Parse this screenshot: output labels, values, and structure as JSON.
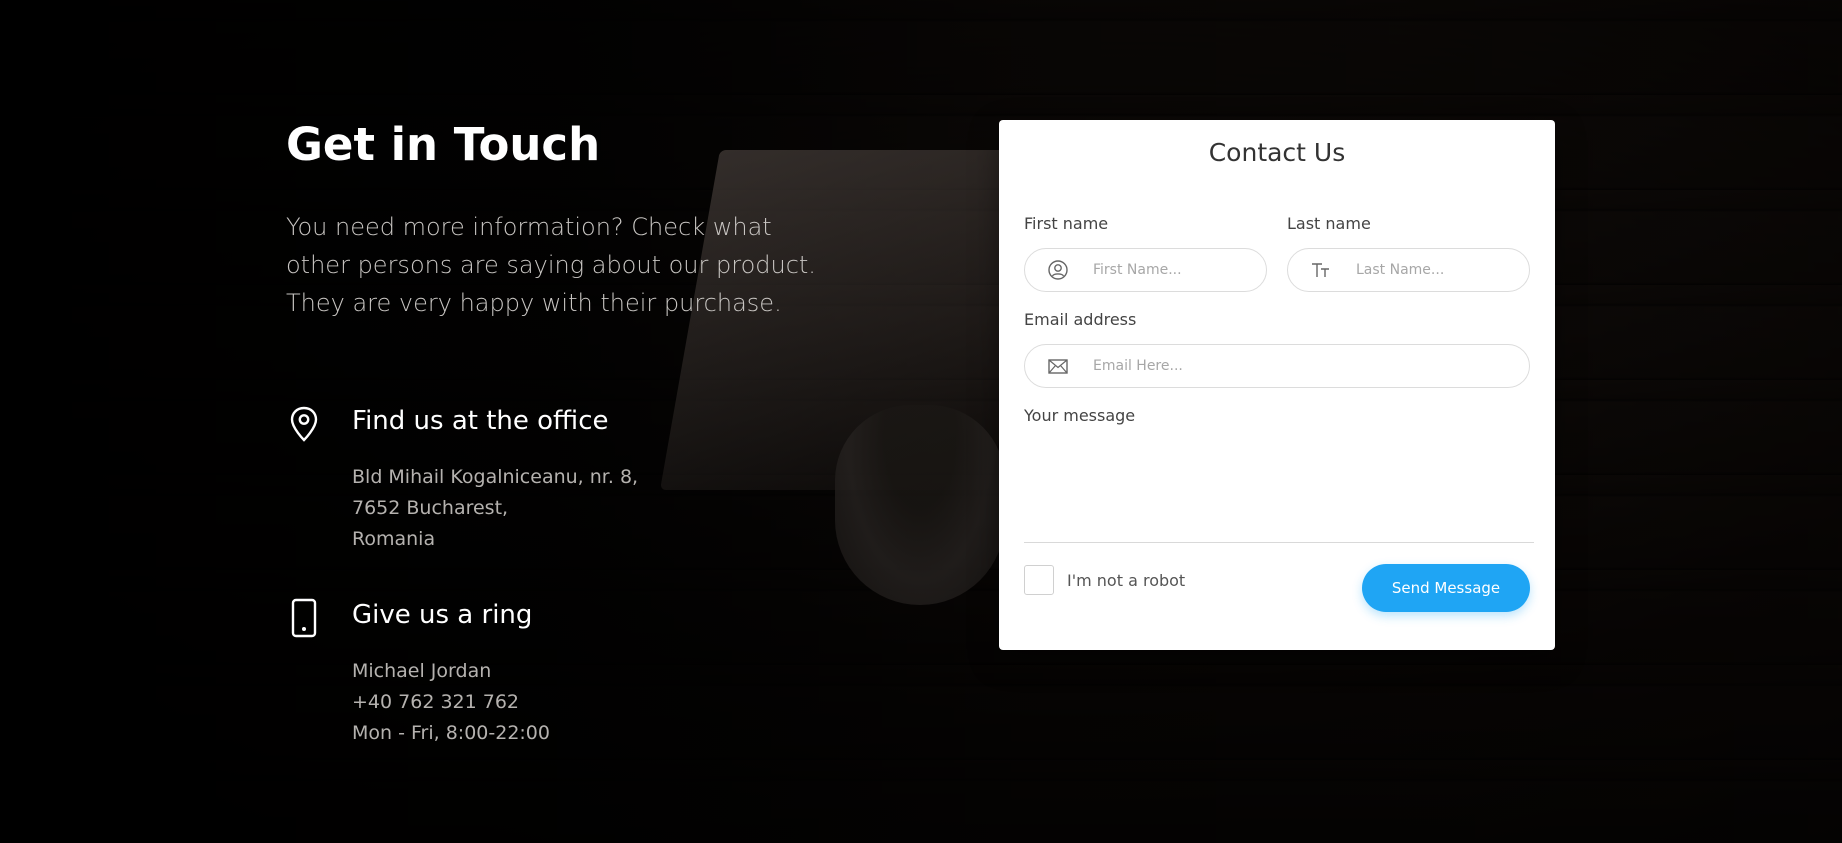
{
  "left": {
    "title": "Get in Touch",
    "intro": "You need more information? Check what other persons are saying about our product. They are very happy with their purchase.",
    "office": {
      "icon": "location-pin-icon",
      "heading": "Find us at the office",
      "lines": [
        "Bld Mihail Kogalniceanu, nr. 8,",
        "7652 Bucharest,",
        "Romania"
      ]
    },
    "ring": {
      "icon": "mobile-phone-icon",
      "heading": "Give us a ring",
      "lines": [
        "Michael Jordan",
        "+40 762 321 762",
        "Mon - Fri, 8:00-22:00"
      ]
    }
  },
  "form": {
    "title": "Contact Us",
    "first_name": {
      "label": "First name",
      "placeholder": "First Name...",
      "icon": "user-circle-icon"
    },
    "last_name": {
      "label": "Last name",
      "placeholder": "Last Name...",
      "icon": "text-size-icon"
    },
    "email": {
      "label": "Email address",
      "placeholder": "Email Here...",
      "icon": "envelope-icon"
    },
    "message": {
      "label": "Your message"
    },
    "captcha_label": "I'm not a robot",
    "submit_label": "Send Message"
  },
  "colors": {
    "accent": "#1fa5f4",
    "card_bg": "#ffffff",
    "text_light": "#ffffff"
  }
}
